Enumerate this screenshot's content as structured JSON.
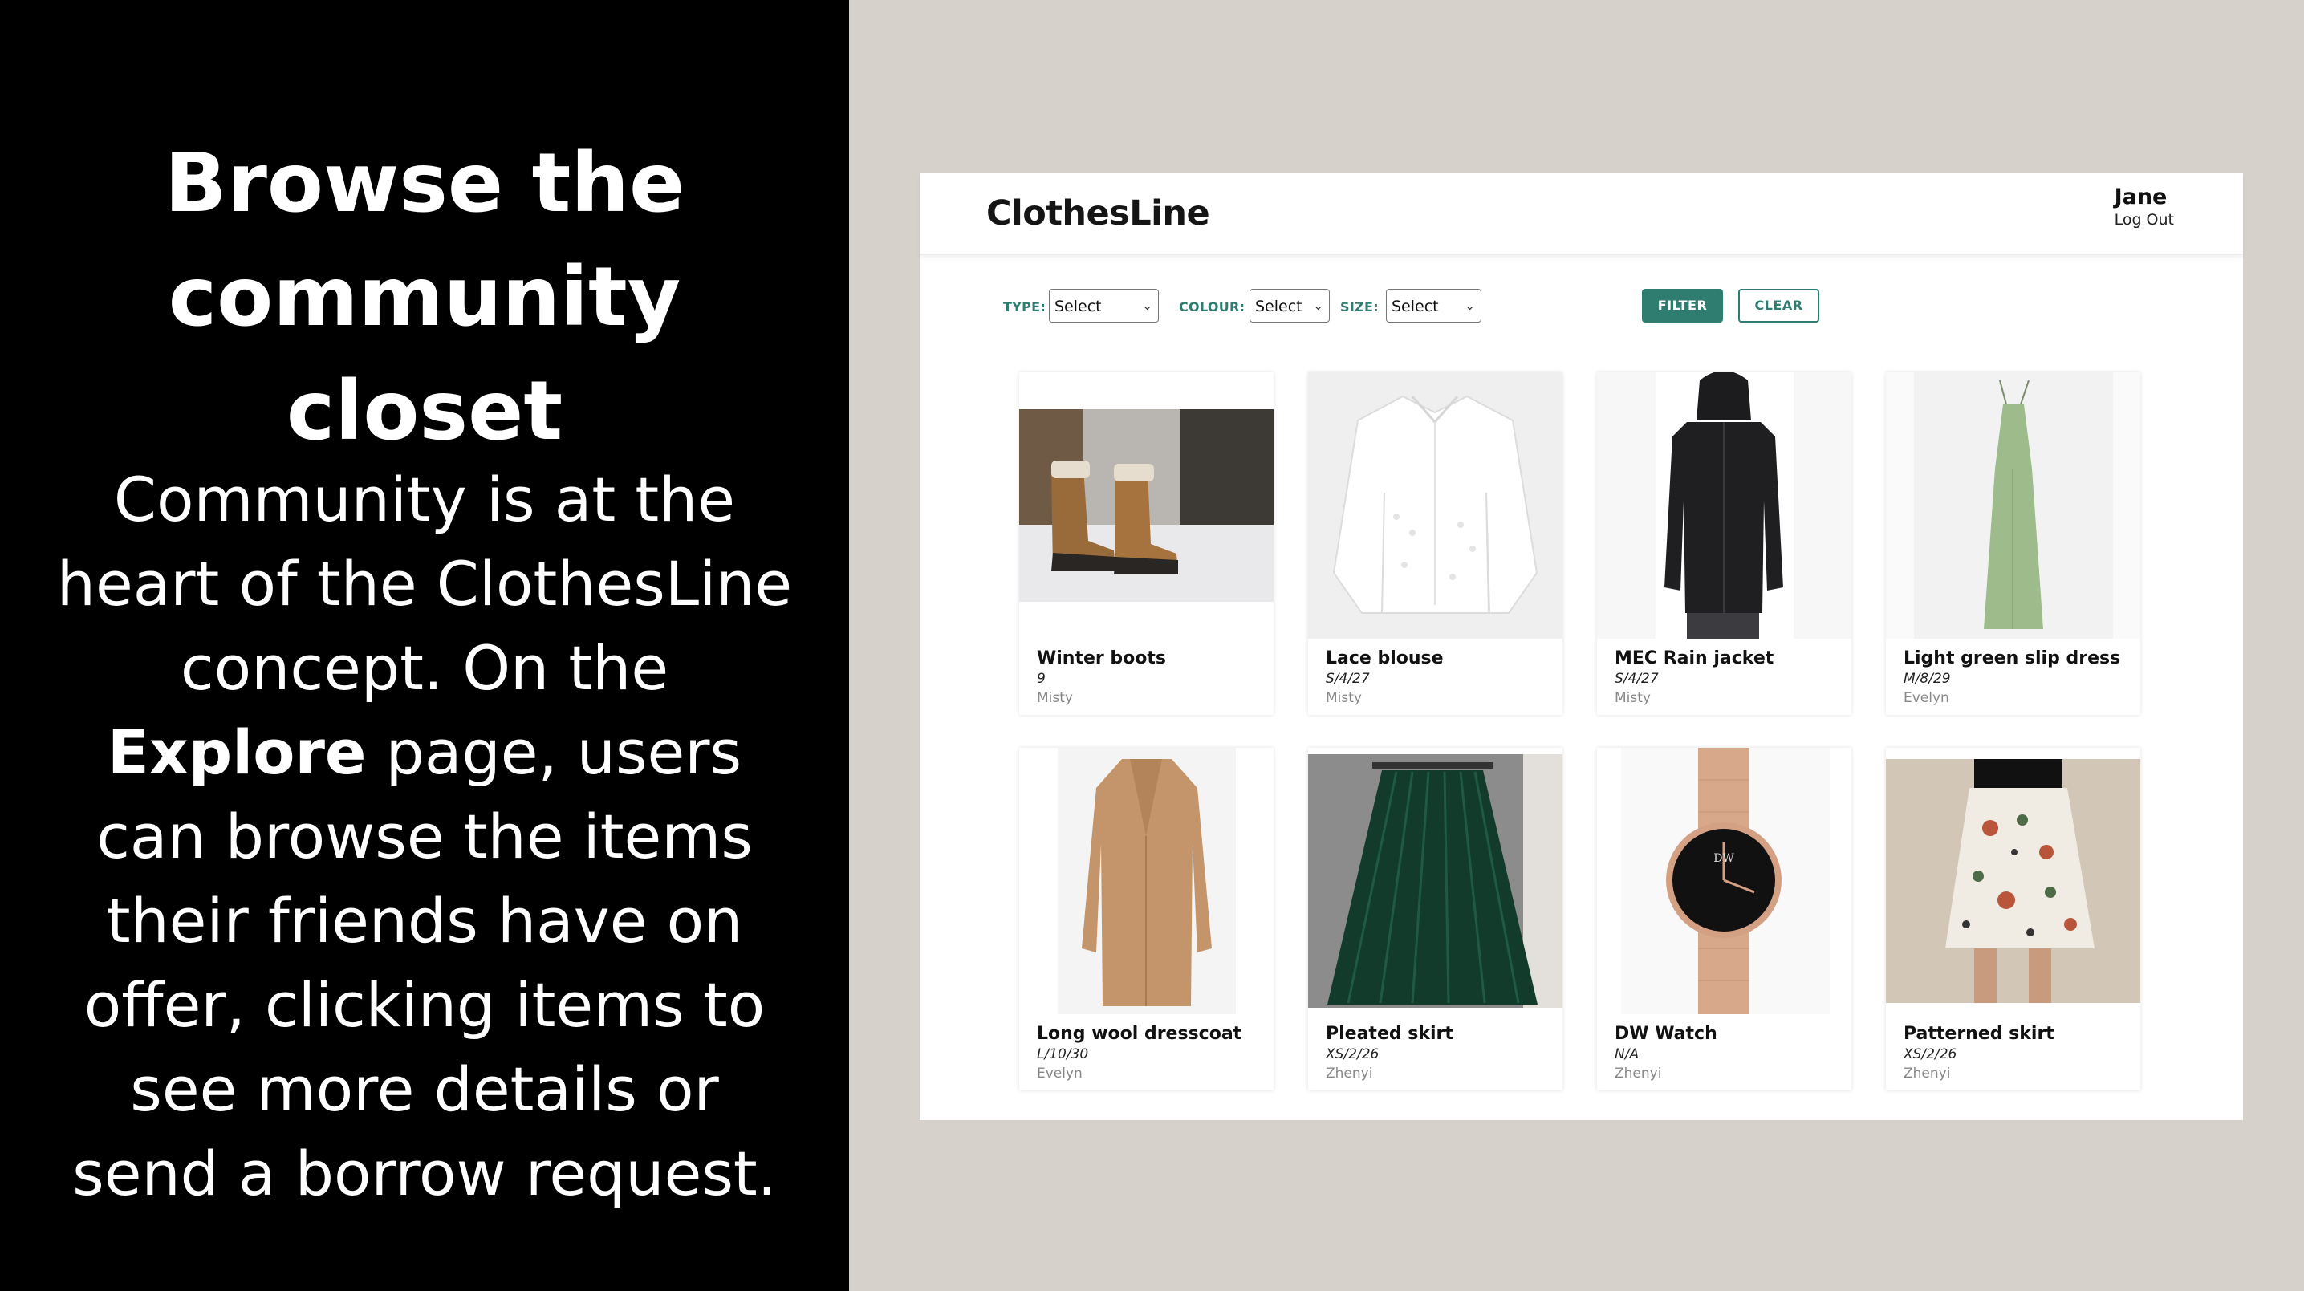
{
  "slide": {
    "title_line1": "Browse the",
    "title_line2": "community closet",
    "body_part1": "Community is at the heart of the ClothesLine concept. On the ",
    "body_bold": "Explore",
    "body_part2": " page, users can browse the items their friends have on offer, clicking items to see more details or send a borrow request."
  },
  "app": {
    "logo": "ClothesLine",
    "user_name": "Jane",
    "logout_label": "Log Out",
    "colors": {
      "accent": "#2f7d71",
      "left_bg": "#000000",
      "page_bg": "#d6d1cb"
    },
    "filters": {
      "type_label": "TYPE:",
      "type_value": "Select",
      "colour_label": "COLOUR:",
      "colour_value": "Select",
      "size_label": "SIZE:",
      "size_value": "Select",
      "filter_button": "FILTER",
      "clear_button": "CLEAR"
    },
    "items": [
      {
        "name": "Winter boots",
        "size": "9",
        "owner": "Misty",
        "image": "brown-winter-boots-in-snow"
      },
      {
        "name": "Lace blouse",
        "size": "S/4/27",
        "owner": "Misty",
        "image": "white-lace-blouse"
      },
      {
        "name": "MEC Rain jacket",
        "size": "S/4/27",
        "owner": "Misty",
        "image": "woman-in-black-rain-jacket"
      },
      {
        "name": "Light green slip dress",
        "size": "M/8/29",
        "owner": "Evelyn",
        "image": "green-slip-dress"
      },
      {
        "name": "Long wool dresscoat",
        "size": "L/10/30",
        "owner": "Evelyn",
        "image": "camel-wool-coat"
      },
      {
        "name": "Pleated skirt",
        "size": "XS/2/26",
        "owner": "Zhenyi",
        "image": "green-velvet-pleated-skirt"
      },
      {
        "name": "DW Watch",
        "size": "N/A",
        "owner": "Zhenyi",
        "image": "rose-gold-mesh-watch"
      },
      {
        "name": "Patterned skirt",
        "size": "XS/2/26",
        "owner": "Zhenyi",
        "image": "floral-patterned-skirt"
      }
    ]
  }
}
